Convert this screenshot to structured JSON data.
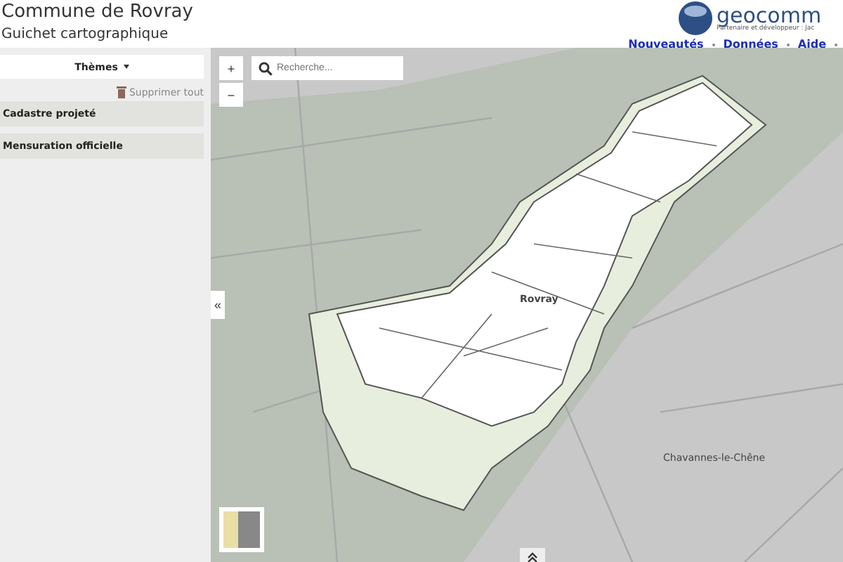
{
  "header": {
    "title": "Commune de Rovray",
    "subtitle": "Guichet cartographique",
    "logo_text": "geocomm",
    "logo_tagline": "Partenaire et développeur : Jac",
    "nav": [
      "Nouveautés",
      "Données",
      "Aide"
    ]
  },
  "sidebar": {
    "themes_button": "Thèmes",
    "clear_all": "Supprimer tout",
    "layers": [
      "Cadastre projeté",
      "Mensuration officielle"
    ],
    "collapse": "«"
  },
  "map": {
    "zoom_in": "+",
    "zoom_out": "−",
    "search": {
      "placeholder": "Recherche..."
    },
    "labels": [
      "Rovray",
      "Chavannes-le-Chêne"
    ]
  }
}
